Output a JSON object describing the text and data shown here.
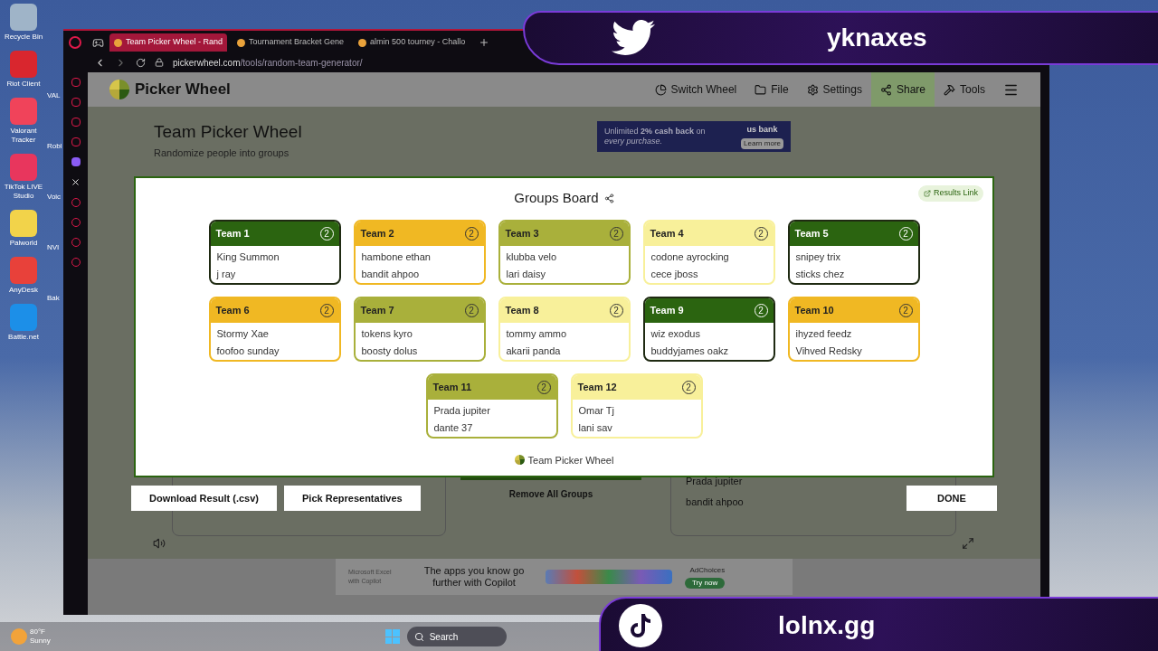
{
  "desktop": {
    "icons": [
      {
        "label": "Recycle Bin",
        "color": "#9fb4c8"
      },
      {
        "label": "Riot Client",
        "color": "#d9262e"
      },
      {
        "label": "Valorant Tracker",
        "color": "#f0435a"
      },
      {
        "label": "TikTok LIVE Studio",
        "color": "#e8365d"
      },
      {
        "label": "Palworld",
        "color": "#f2d34a"
      },
      {
        "label": "AnyDesk",
        "color": "#e8413a"
      },
      {
        "label": "Battle.net",
        "color": "#1c8fe8"
      }
    ],
    "partial_icons": [
      {
        "label": "VAL"
      },
      {
        "label": "Robl"
      },
      {
        "label": "Voic"
      },
      {
        "label": "NVI"
      },
      {
        "label": "Bak"
      }
    ]
  },
  "browser": {
    "tabs": [
      {
        "title": "Team Picker Wheel - Rand",
        "selected": true
      },
      {
        "title": "Tournament Bracket Gene",
        "selected": false
      },
      {
        "title": "almin 500 tourney - Challo",
        "selected": false
      }
    ],
    "address_host": "pickerwheel.com",
    "address_path": "/tools/random-team-generator/"
  },
  "site": {
    "logo": "Picker Wheel",
    "nav": [
      {
        "label": "Switch Wheel",
        "selected": false
      },
      {
        "label": "File",
        "selected": false
      },
      {
        "label": "Settings",
        "selected": false
      },
      {
        "label": "Share",
        "selected": true
      },
      {
        "label": "Tools",
        "selected": false
      }
    ],
    "title": "Team Picker Wheel",
    "subtitle": "Randomize people into groups",
    "ad": {
      "text": "Unlimited **2% cash back** on",
      "text2": "every purchase.",
      "brand": "us bank",
      "cta": "Learn more"
    }
  },
  "modal": {
    "title": "Groups Board",
    "results_link": "Results Link",
    "teams": [
      {
        "name": "Team 1",
        "count": "2",
        "color": "#2b6410",
        "members": [
          "King Summon",
          "j ray"
        ]
      },
      {
        "name": "Team 2",
        "count": "2",
        "color": "#f0b823",
        "members": [
          "hambone ethan",
          "bandit ahpoo"
        ]
      },
      {
        "name": "Team 3",
        "count": "2",
        "color": "#a9b03b",
        "members": [
          "klubba velo",
          "lari daisy"
        ]
      },
      {
        "name": "Team 4",
        "count": "2",
        "color": "#f8f09a",
        "members": [
          "codone ayrocking",
          "cece jboss"
        ]
      },
      {
        "name": "Team 5",
        "count": "2",
        "color": "#2b6410",
        "members": [
          "snipey trix",
          "sticks chez"
        ]
      },
      {
        "name": "Team 6",
        "count": "2",
        "color": "#f0b823",
        "members": [
          "Stormy Xae",
          "foofoo sunday"
        ]
      },
      {
        "name": "Team 7",
        "count": "2",
        "color": "#a9b03b",
        "members": [
          "tokens kyro",
          "boosty dolus"
        ]
      },
      {
        "name": "Team 8",
        "count": "2",
        "color": "#f8f09a",
        "members": [
          "tommy ammo",
          "akarii panda"
        ]
      },
      {
        "name": "Team 9",
        "count": "2",
        "color": "#2b6410",
        "members": [
          "wiz exodus",
          "buddyjames oakz"
        ]
      },
      {
        "name": "Team 10",
        "count": "2",
        "color": "#f0b823",
        "members": [
          "ihyzed feedz",
          "Vihved Redsky"
        ]
      },
      {
        "name": "Team 11",
        "count": "2",
        "color": "#a9b03b",
        "members": [
          "Prada jupiter",
          "dante 37"
        ]
      },
      {
        "name": "Team 12",
        "count": "2",
        "color": "#f8f09a",
        "members": [
          "Omar Tj",
          "lani sav"
        ]
      }
    ],
    "footer": "Team Picker Wheel",
    "buttons": [
      "Download Result (.csv)",
      "Pick Representatives"
    ],
    "done": "DONE"
  },
  "background": {
    "remove": "Remove All Groups",
    "names": [
      "Prada jupiter",
      "bandit ahpoo"
    ]
  },
  "bottom_ad": {
    "brand": "Microsoft Excel with Copilot",
    "headline": "The apps you know go further with Copilot",
    "cta": "Try now",
    "choices": "AdChoices"
  },
  "overlay": {
    "top": "yknaxes",
    "bottom": "lolnx.gg"
  },
  "taskbar": {
    "temp": "80°F",
    "weather": "Sunny",
    "search": "Search"
  }
}
